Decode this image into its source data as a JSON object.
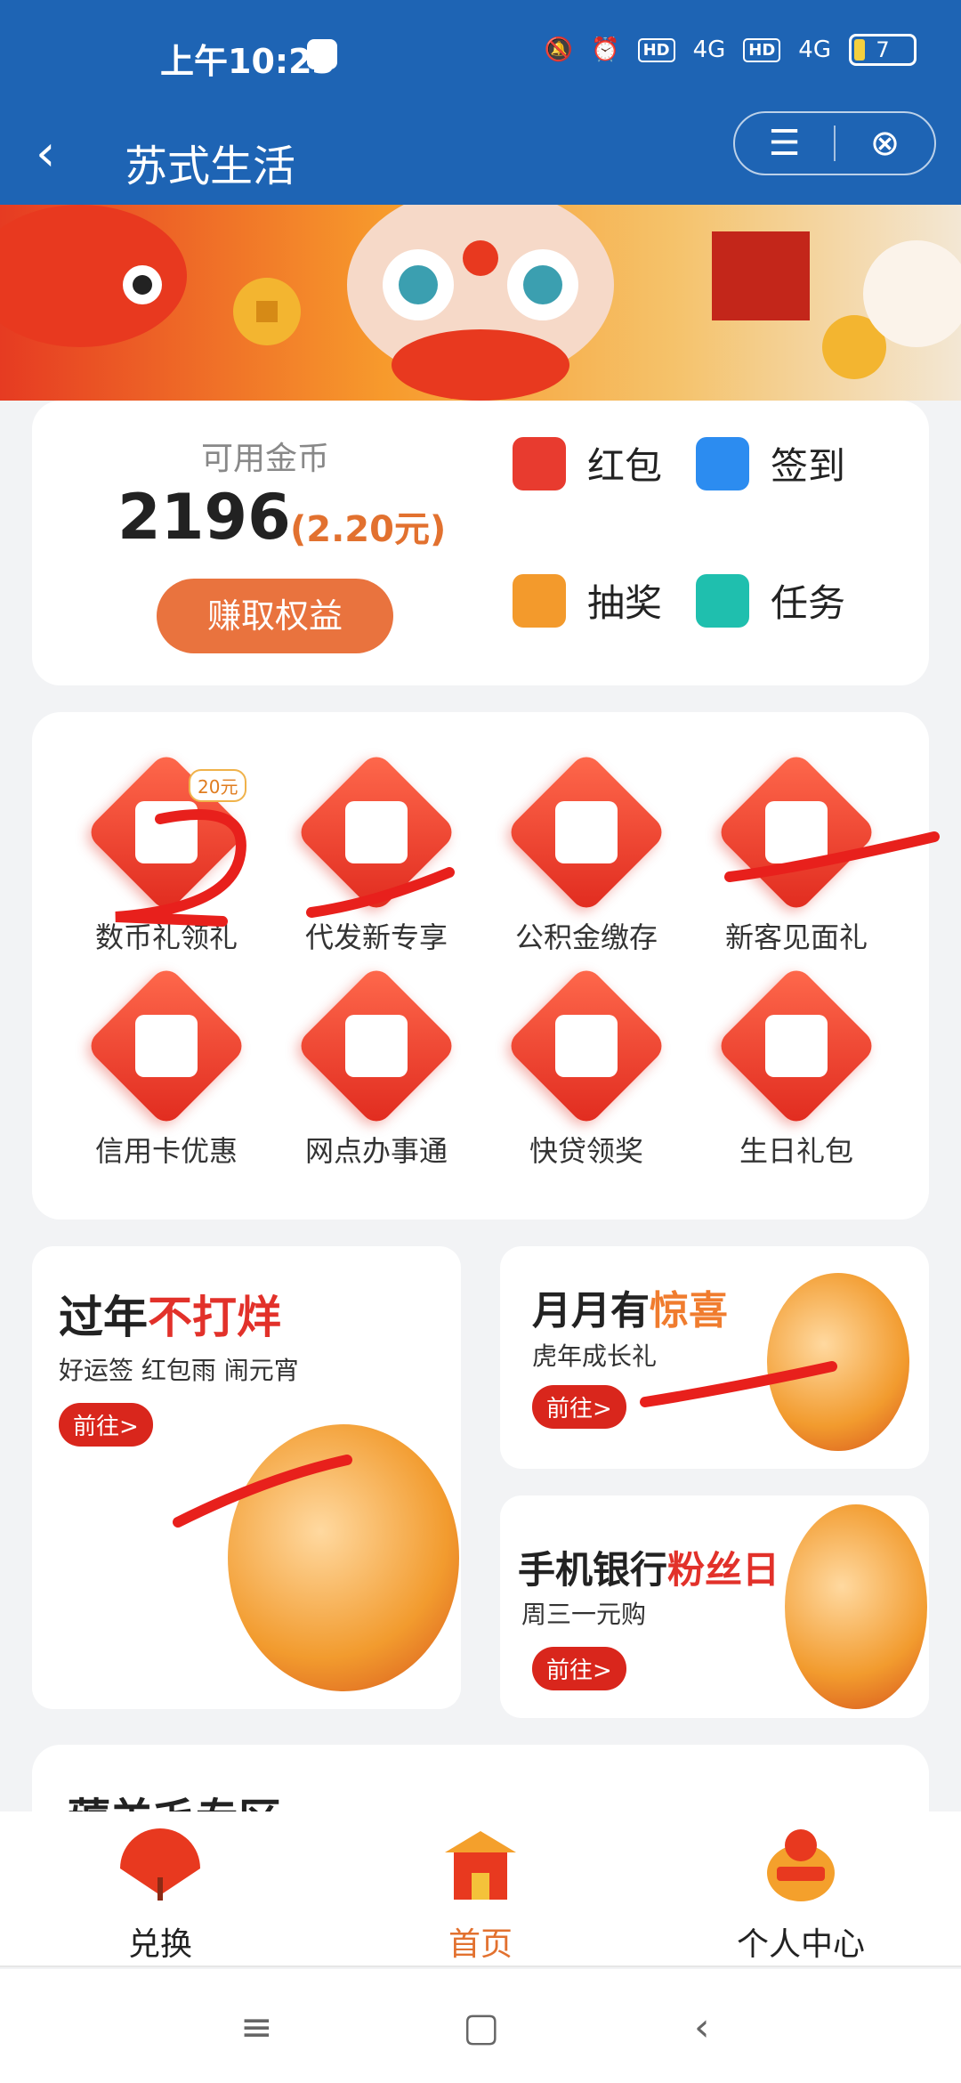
{
  "status_bar": {
    "time": "上午10:23",
    "hd1": "HD",
    "net1": "4G",
    "hd2": "HD",
    "net2": "4G",
    "battery": "7"
  },
  "nav": {
    "back_icon": "chevron-left-icon",
    "title": "苏式生活",
    "menu_icon": "menu-icon",
    "close_icon": "close-circle-icon"
  },
  "coins": {
    "label": "可用金币",
    "amount": "2196",
    "yuan": "(2.20元)",
    "earn_button": "赚取权益"
  },
  "quick_actions": [
    {
      "label": "红包",
      "icon": "red-envelope-icon",
      "color": "#e83b2f"
    },
    {
      "label": "签到",
      "icon": "calendar-check-icon",
      "color": "#2c8cf0"
    },
    {
      "label": "抽奖",
      "icon": "gift-icon",
      "color": "#f39a2c"
    },
    {
      "label": "任务",
      "icon": "clipboard-icon",
      "color": "#1fbfae"
    }
  ],
  "services": [
    {
      "label": "数币礼领礼",
      "badge": "20元",
      "icon": "digital-currency-icon"
    },
    {
      "label": "代发新专享",
      "icon": "box-icon"
    },
    {
      "label": "公积金缴存",
      "icon": "envelope-icon"
    },
    {
      "label": "新客见面礼",
      "icon": "coins-icon"
    },
    {
      "label": "信用卡优惠",
      "icon": "credit-card-icon"
    },
    {
      "label": "网点办事通",
      "icon": "shop-icon"
    },
    {
      "label": "快贷领奖",
      "icon": "medal-icon"
    },
    {
      "label": "生日礼包",
      "icon": "cake-icon"
    }
  ],
  "promos": {
    "new_year": {
      "title_plain": "过年",
      "title_highlight": "不打烊",
      "subtitle": "好运签 红包雨 闹元宵",
      "button": "前往>"
    },
    "monthly": {
      "title_plain": "月月有",
      "title_highlight": "惊喜",
      "subtitle": "虎年成长礼",
      "button": "前往>"
    },
    "fans_day": {
      "title_plain": "手机银行",
      "title_highlight": "粉丝日",
      "subtitle": "周三一元购",
      "button": "前往>"
    }
  },
  "section": {
    "title": "薅羊毛专区"
  },
  "tabs": [
    {
      "label": "兑换",
      "icon": "fan-icon"
    },
    {
      "label": "首页",
      "icon": "gate-icon"
    },
    {
      "label": "个人中心",
      "icon": "fortune-bag-icon"
    }
  ],
  "system_nav": {
    "menu": "≡",
    "home": "▢",
    "back": "‹"
  },
  "colors": {
    "brand_blue": "#1e64b4",
    "accent_orange": "#e9733e",
    "red": "#e2312a"
  }
}
